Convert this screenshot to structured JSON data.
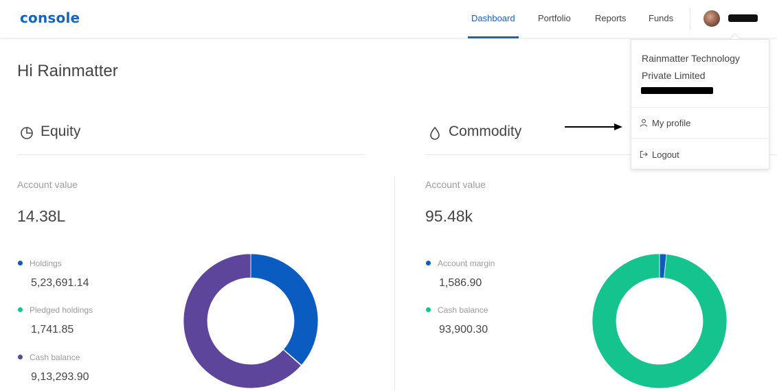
{
  "header": {
    "logo": "console",
    "nav": [
      {
        "label": "Dashboard",
        "active": true
      },
      {
        "label": "Portfolio",
        "active": false
      },
      {
        "label": "Reports",
        "active": false
      },
      {
        "label": "Funds",
        "active": false
      }
    ]
  },
  "greeting": "Hi Rainmatter",
  "equity": {
    "title": "Equity",
    "icon": "pie-chart-icon",
    "account_label": "Account value",
    "account_value": "14.38L",
    "legend": [
      {
        "label": "Holdings",
        "value": "5,23,691.14",
        "color": "#0b5cc0"
      },
      {
        "label": "Pledged holdings",
        "value": "1,741.85",
        "color": "#14c38e"
      },
      {
        "label": "Cash balance",
        "value": "9,13,293.90",
        "color": "#5c459a"
      }
    ]
  },
  "commodity": {
    "title": "Commodity",
    "icon": "drop-icon",
    "account_label": "Account value",
    "account_value": "95.48k",
    "legend": [
      {
        "label": "Account margin",
        "value": "1,586.90",
        "color": "#0b5cc0"
      },
      {
        "label": "Cash balance",
        "value": "93,900.30",
        "color": "#14c38e"
      }
    ]
  },
  "dropdown": {
    "org_name": "Rainmatter Technology Private Limited",
    "items": [
      {
        "label": "My profile",
        "icon": "user-icon"
      },
      {
        "label": "Logout",
        "icon": "logout-icon"
      }
    ]
  },
  "chart_data": [
    {
      "type": "pie",
      "categories": [
        "Holdings",
        "Pledged holdings",
        "Cash balance"
      ],
      "values": [
        523691.14,
        1741.85,
        913293.9
      ],
      "colors": [
        "#0b5cc0",
        "#14c38e",
        "#5c459a"
      ]
    },
    {
      "type": "pie",
      "categories": [
        "Account margin",
        "Cash balance"
      ],
      "values": [
        1586.9,
        93900.3
      ],
      "colors": [
        "#0b5cc0",
        "#14c38e"
      ]
    }
  ]
}
